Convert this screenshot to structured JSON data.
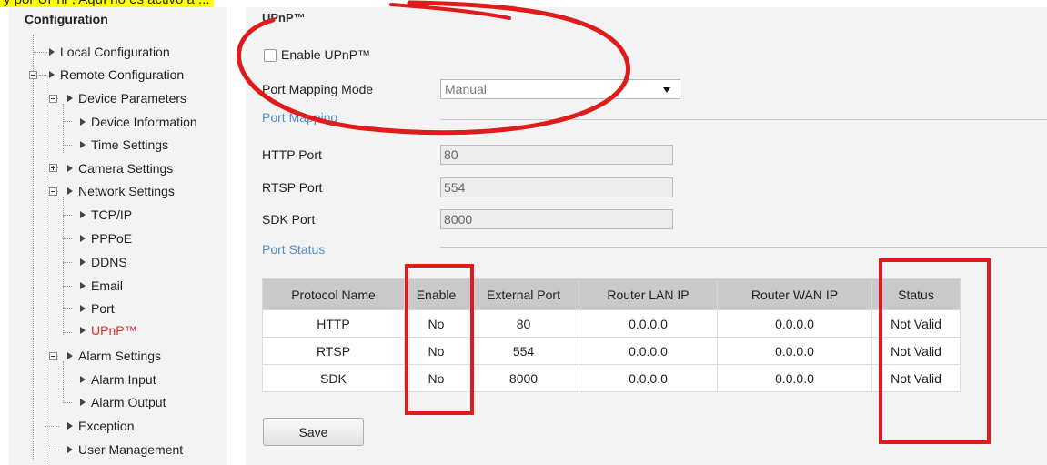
{
  "caption": {
    "text": "y por UPnP, Aquí no es activo a ..."
  },
  "sidebar": {
    "header": "Configuration",
    "items": [
      {
        "label": "Local Configuration"
      },
      {
        "label": "Remote Configuration"
      },
      {
        "label": "Device Parameters"
      },
      {
        "label": "Device Information"
      },
      {
        "label": "Time Settings"
      },
      {
        "label": "Camera Settings"
      },
      {
        "label": "Network Settings"
      },
      {
        "label": "TCP/IP"
      },
      {
        "label": "PPPoE"
      },
      {
        "label": "DDNS"
      },
      {
        "label": "Email"
      },
      {
        "label": "Port"
      },
      {
        "label": "UPnP™"
      },
      {
        "label": "Alarm Settings"
      },
      {
        "label": "Alarm Input"
      },
      {
        "label": "Alarm Output"
      },
      {
        "label": "Exception"
      },
      {
        "label": "User Management"
      }
    ]
  },
  "main": {
    "title": "UPnP™",
    "enable_label": "Enable UPnP™",
    "enable_checked": false,
    "mode_label": "Port Mapping Mode",
    "mode_value": "Manual",
    "port_mapping_title": "Port Mapping",
    "http_label": "HTTP Port",
    "http_value": "80",
    "rtsp_label": "RTSP Port",
    "rtsp_value": "554",
    "sdk_label": "SDK Port",
    "sdk_value": "8000",
    "port_status_title": "Port Status",
    "table": {
      "headers": [
        "Protocol Name",
        "Enable",
        "External Port",
        "Router LAN IP",
        "Router WAN IP",
        "Status"
      ],
      "rows": [
        [
          "HTTP",
          "No",
          "80",
          "0.0.0.0",
          "0.0.0.0",
          "Not Valid"
        ],
        [
          "RTSP",
          "No",
          "554",
          "0.0.0.0",
          "0.0.0.0",
          "Not Valid"
        ],
        [
          "SDK",
          "No",
          "8000",
          "0.0.0.0",
          "0.0.0.0",
          "Not Valid"
        ]
      ]
    },
    "save_label": "Save"
  },
  "colors": {
    "active_nav": "#e8262a",
    "section_title": "#4f8fd0",
    "annotation": "#e01b1b",
    "caption_highlight": "#ffff00"
  }
}
